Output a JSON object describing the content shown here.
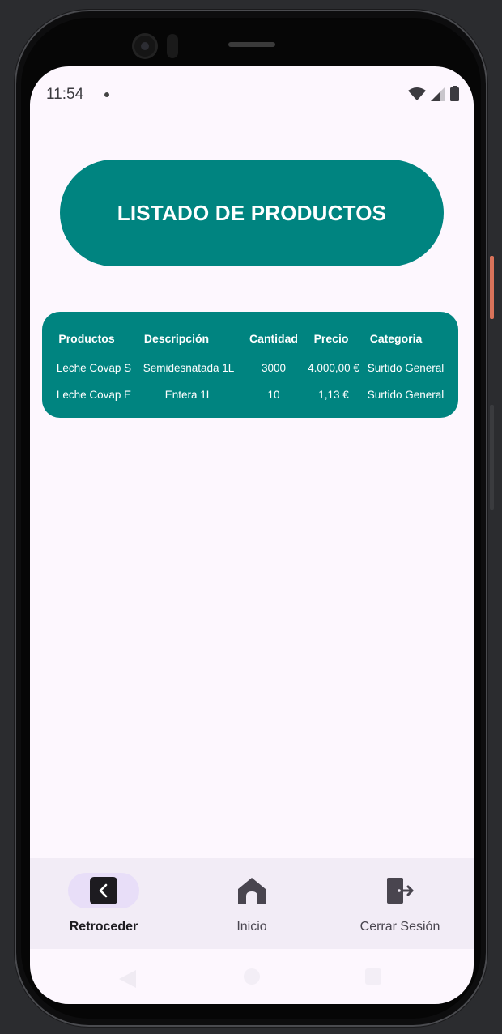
{
  "status_bar": {
    "time": "11:54"
  },
  "page": {
    "title": "LISTADO DE PRODUCTOS"
  },
  "table": {
    "headers": [
      "Productos",
      "Descripción",
      "Cantidad",
      "Precio",
      "Categoria"
    ],
    "rows": [
      [
        "Leche Covap S",
        "Semidesnatada 1L",
        "3000",
        "4.000,00 €",
        "Surtido General"
      ],
      [
        "Leche Covap E",
        "Entera 1L",
        "10",
        "1,13 €",
        "Surtido General"
      ]
    ]
  },
  "bottom_nav": {
    "items": [
      {
        "label": "Retroceder",
        "icon": "back-icon",
        "active": true
      },
      {
        "label": "Inicio",
        "icon": "home-icon",
        "active": false
      },
      {
        "label": "Cerrar Sesión",
        "icon": "logout-icon",
        "active": false
      }
    ]
  },
  "colors": {
    "accent": "#008480",
    "background": "#fdf7fe",
    "nav_background": "#f2ecf6",
    "active_indicator": "#e8def8"
  }
}
